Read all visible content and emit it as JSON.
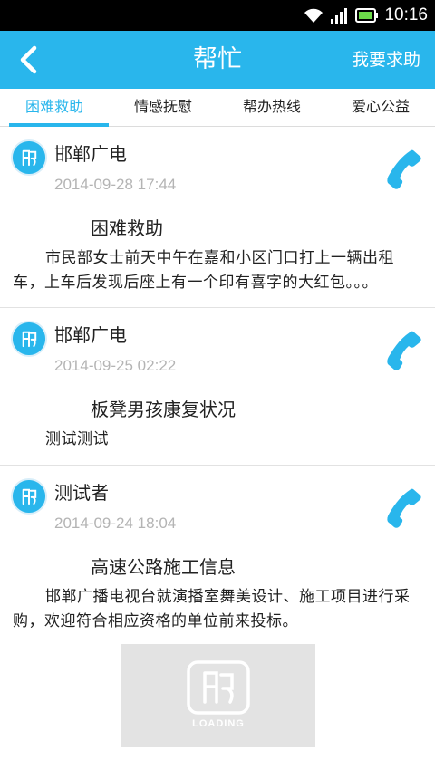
{
  "status_bar": {
    "time": "10:16"
  },
  "header": {
    "title": "帮忙",
    "action_label": "我要求助"
  },
  "tabs": [
    {
      "label": "困难救助",
      "active": true
    },
    {
      "label": "情感抚慰",
      "active": false
    },
    {
      "label": "帮办热线",
      "active": false
    },
    {
      "label": "爱心公益",
      "active": false
    }
  ],
  "feed": [
    {
      "source": "邯郸广电",
      "date": "2014-09-28 17:44",
      "headline": "困难救助",
      "body": "市民部女士前天中午在嘉和小区门口打上一辆出租车，上车后发现后座上有一个印有喜字的大红包。。。"
    },
    {
      "source": "邯郸广电",
      "date": "2014-09-25 02:22",
      "headline": "板凳男孩康复状况",
      "body": "测试测试"
    },
    {
      "source": "测试者",
      "date": "2014-09-24 18:04",
      "headline": "高速公路施工信息",
      "body": "邯郸广播电视台就演播室舞美设计、施工项目进行采购，欢迎符合相应资格的单位前来投标。"
    }
  ],
  "loading": {
    "text": "LOADING"
  },
  "colors": {
    "accent": "#29b6ec",
    "date_gray": "#b4b4b4"
  }
}
